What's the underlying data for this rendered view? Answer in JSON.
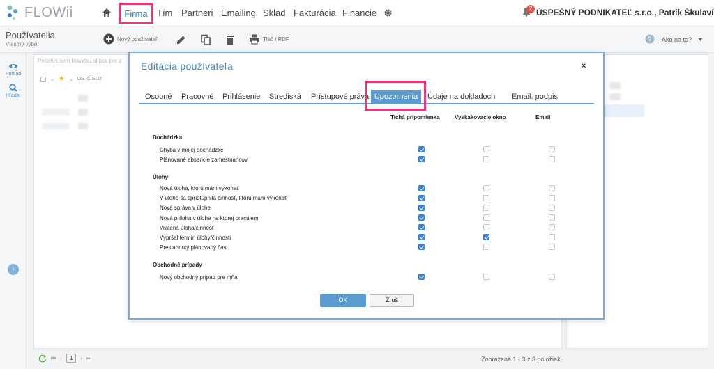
{
  "brand": {
    "name": "FLOWii",
    "accent": "#2f8ac8",
    "highlight": "#e8367a"
  },
  "nav": {
    "items": [
      {
        "label": "Firma",
        "highlighted": true
      },
      {
        "label": "Tím"
      },
      {
        "label": "Partneri"
      },
      {
        "label": "Emailing"
      },
      {
        "label": "Sklad"
      },
      {
        "label": "Fakturácia"
      },
      {
        "label": "Financie"
      }
    ],
    "notification_count": "2",
    "company": "ÚSPEŠNÝ PODNIKATEĽ s.r.o., Patrik Škulavík"
  },
  "toolbar": {
    "page_title": "Používatelia",
    "page_subtitle": "Vlastný výber",
    "new_user_label": "Nový používateľ",
    "print_label": "Tlač / PDF",
    "help_label": "Ako na to?"
  },
  "rail": {
    "view_label": "Pohľad",
    "search_label": "Hľadaj"
  },
  "background": {
    "drag_hint": "Potiahni sem hlavičku stĺpca pre z",
    "column_header": "OS. ČÍSLO",
    "page_number": "1",
    "pager_info": "Zobrazené 1 - 3 z 3 položiek"
  },
  "modal": {
    "title": "Editácia používateľa",
    "close": "×",
    "tabs": [
      {
        "label": "Osobné"
      },
      {
        "label": "Pracovné"
      },
      {
        "label": "Prihlásenie"
      },
      {
        "label": "Strediská"
      },
      {
        "label": "Prístupové práva"
      },
      {
        "label": "Upozornenia",
        "active": true
      },
      {
        "label": "Údaje na dokladoch"
      },
      {
        "label": "Email. podpis"
      }
    ],
    "columns": [
      "Tichá pripomienka",
      "Vyskakovacie okno",
      "Email"
    ],
    "sections": [
      {
        "title": "Dochádzka",
        "rows": [
          {
            "label": "Chyba v mojej dochádzke",
            "checks": [
              true,
              false,
              false
            ]
          },
          {
            "label": "Plánované absencie zamestnancov",
            "checks": [
              true,
              false,
              false
            ]
          }
        ]
      },
      {
        "title": "Úlohy",
        "rows": [
          {
            "label": "Nová úloha, ktorú mám vykonať",
            "checks": [
              true,
              false,
              false
            ]
          },
          {
            "label": "V úlohe sa sprístupnila činnosť, ktorú mám vykonať",
            "checks": [
              true,
              false,
              false
            ]
          },
          {
            "label": "Nová správa v úlohe",
            "checks": [
              true,
              false,
              false
            ]
          },
          {
            "label": "Nová príloha v úlohe na ktorej pracujem",
            "checks": [
              true,
              false,
              false
            ]
          },
          {
            "label": "Vrátená úloha/činnosť",
            "checks": [
              true,
              false,
              false
            ]
          },
          {
            "label": "Vypršal termín úlohy/činnosti",
            "checks": [
              true,
              true,
              false
            ]
          },
          {
            "label": "Presiahnutý plánovaný čas",
            "checks": [
              true,
              false,
              false
            ]
          }
        ]
      },
      {
        "title": "Obchodné prípady",
        "rows": [
          {
            "label": "Nový obchodný prípad pre mňa",
            "checks": [
              true,
              false,
              false
            ]
          }
        ]
      }
    ],
    "ok_label": "OK",
    "cancel_label": "Zruš"
  }
}
